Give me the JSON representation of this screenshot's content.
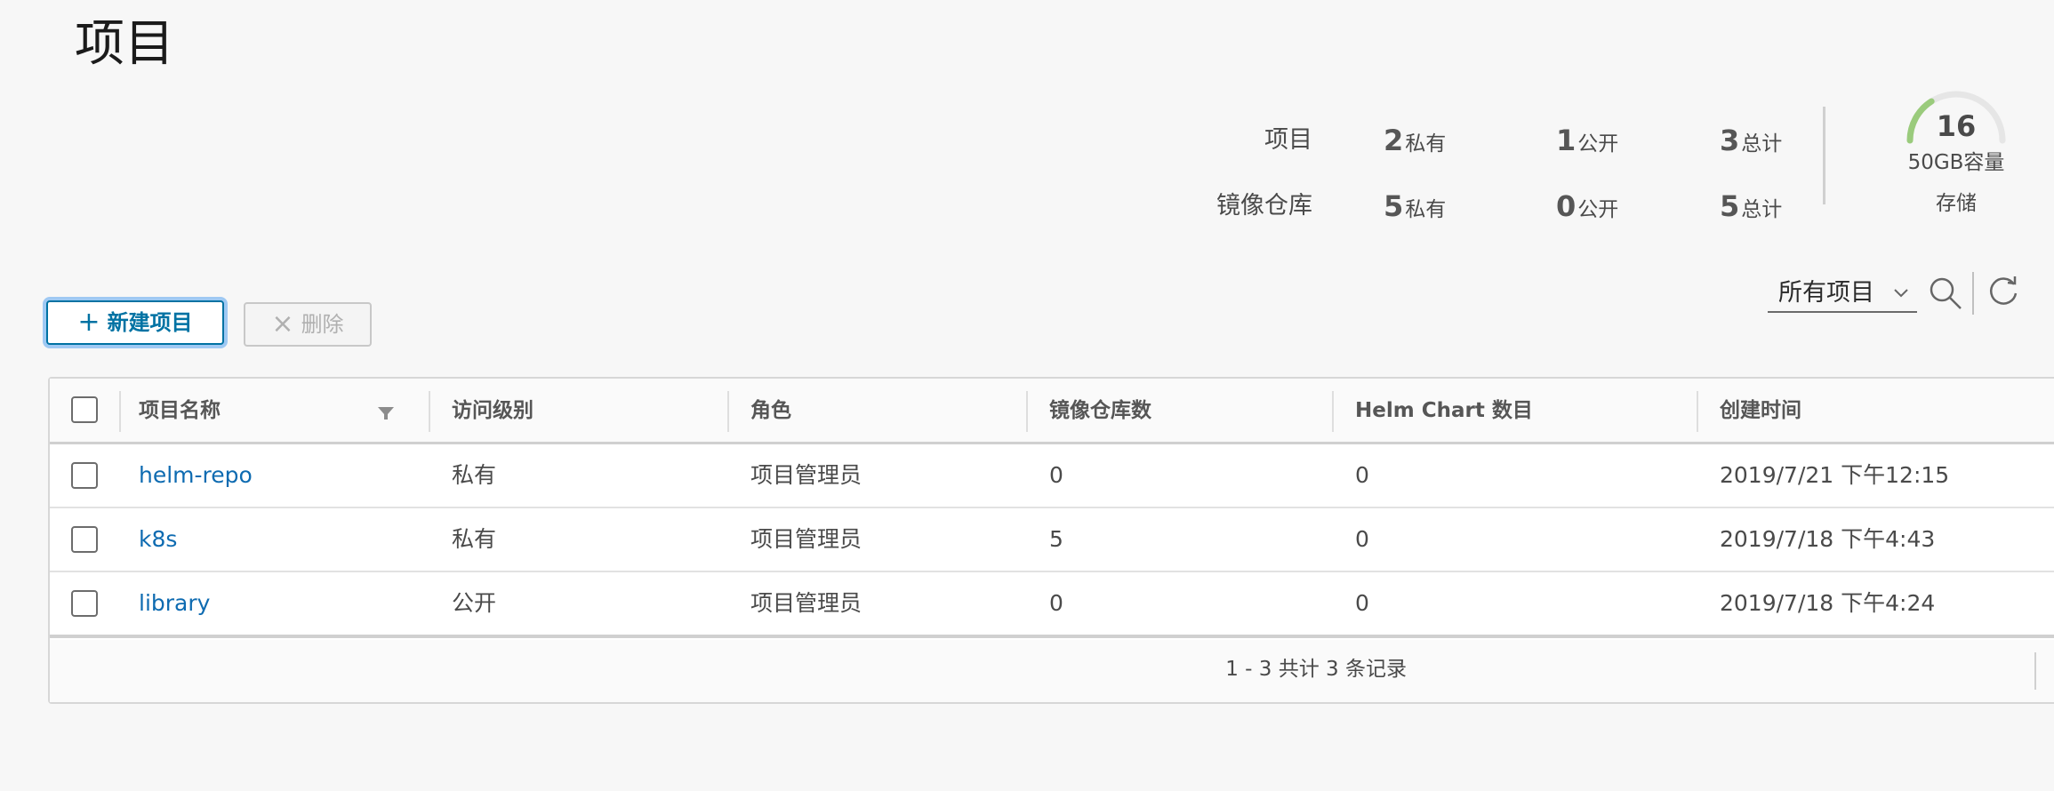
{
  "page": {
    "title": "项目"
  },
  "summary": {
    "projects": {
      "label": "项目",
      "private_num": "2",
      "private_unit": "私有",
      "public_num": "1",
      "public_unit": "公开",
      "total_num": "3",
      "total_unit": "总计"
    },
    "repos": {
      "label": "镜像仓库",
      "private_num": "5",
      "private_unit": "私有",
      "public_num": "0",
      "public_unit": "公开",
      "total_num": "5",
      "total_unit": "总计"
    },
    "storage": {
      "value": "16",
      "capacity": "50GB容量",
      "label": "存储",
      "used_fraction": 0.32,
      "accent": "#9acb7c",
      "track": "#e6e6e6"
    }
  },
  "toolbar": {
    "new_label": "新建项目",
    "delete_label": "删除",
    "filter_selected": "所有项目"
  },
  "table": {
    "columns": [
      "项目名称",
      "访问级别",
      "角色",
      "镜像仓库数",
      "Helm Chart 数目",
      "创建时间"
    ],
    "rows": [
      {
        "name": "helm-repo",
        "access": "私有",
        "role": "项目管理员",
        "repos": "0",
        "charts": "0",
        "created": "2019/7/21 下午12:15"
      },
      {
        "name": "k8s",
        "access": "私有",
        "role": "项目管理员",
        "repos": "5",
        "charts": "0",
        "created": "2019/7/18 下午4:43"
      },
      {
        "name": "library",
        "access": "公开",
        "role": "项目管理员",
        "repos": "0",
        "charts": "0",
        "created": "2019/7/18 下午4:24"
      }
    ],
    "footer": "1 - 3 共计 3 条记录"
  }
}
